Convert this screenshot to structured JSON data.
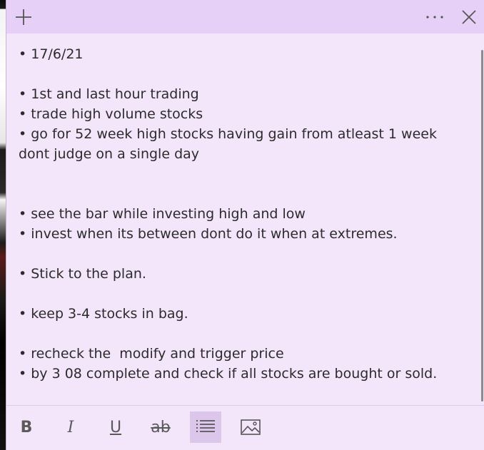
{
  "note": {
    "lines": [
      "• 17/6/21",
      "",
      "• 1st and last hour trading",
      "• trade high volume stocks",
      "• go for 52 week high stocks having gain from atleast 1 week dont judge on a single day",
      "",
      "",
      "• see the bar while investing high and low",
      "• invest when its between dont do it when at extremes.",
      "",
      "• Stick to the plan.",
      "",
      "• keep 3-4 stocks in bag.",
      "",
      "• recheck the  modify and trigger price",
      "• by 3 08 complete and check if all stocks are bought or sold."
    ]
  },
  "titlebar": {
    "icons": [
      "plus-icon",
      "more-icon",
      "close-icon"
    ]
  },
  "toolbar": {
    "bold_label": "B",
    "italic_label": "I",
    "underline_label": "U",
    "strikethrough_label": "ab",
    "icons": [
      "bold-icon",
      "italic-icon",
      "underline-icon",
      "strikethrough-icon",
      "bullet-list-icon",
      "image-icon"
    ],
    "active_tool": "bullet-list"
  },
  "colors": {
    "note_background": "#f3e6fb",
    "titlebar_background": "#e6d0f8",
    "active_tool_background": "#dcc6ea"
  }
}
